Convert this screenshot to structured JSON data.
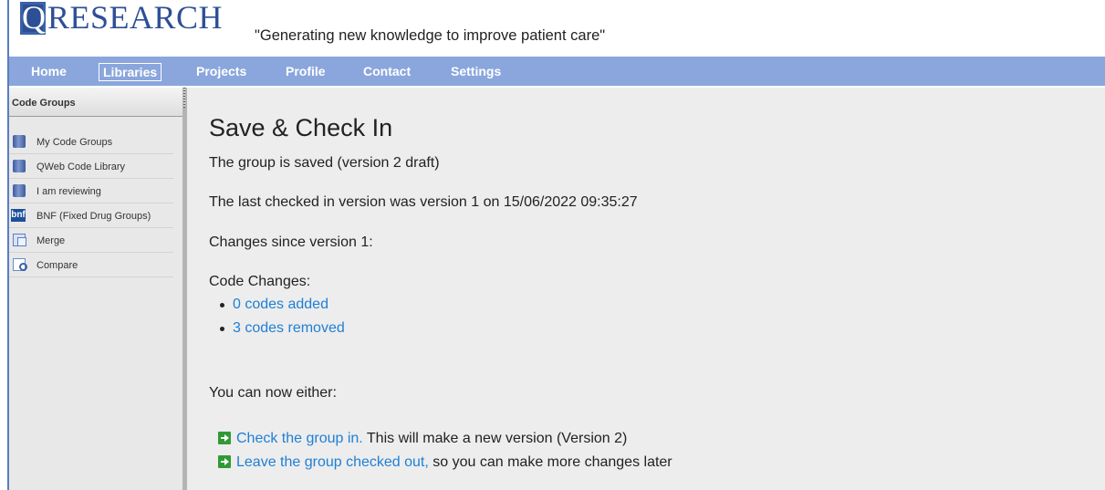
{
  "header": {
    "logo_q": "Q",
    "logo_text": "RESEARCH",
    "tagline": "\"Generating new knowledge to improve patient care\""
  },
  "nav": {
    "items": [
      {
        "label": "Home"
      },
      {
        "label": "Libraries",
        "active": true
      },
      {
        "label": "Projects"
      },
      {
        "label": "Profile"
      },
      {
        "label": "Contact"
      },
      {
        "label": "Settings"
      }
    ]
  },
  "sidebar": {
    "title": "Code Groups",
    "items": [
      {
        "label": "My Code Groups",
        "icon": "database-icon"
      },
      {
        "label": "QWeb Code Library",
        "icon": "database-icon"
      },
      {
        "label": "I am reviewing",
        "icon": "database-icon"
      },
      {
        "label": "BNF (Fixed Drug Groups)",
        "icon": "bnf-icon",
        "icon_text": "bnf"
      },
      {
        "label": "Merge",
        "icon": "merge-icon"
      },
      {
        "label": "Compare",
        "icon": "compare-icon"
      }
    ]
  },
  "main": {
    "title": "Save & Check In",
    "saved_text": "The group is saved (version 2 draft)",
    "last_checked_in": "The last checked in version was version 1 on 15/06/2022 09:35:27",
    "changes_since": "Changes since version 1:",
    "code_changes_label": "Code Changes:",
    "code_changes": [
      {
        "label": "0 codes added"
      },
      {
        "label": "3 codes removed"
      }
    ],
    "either_text": "You can now either:",
    "actions": [
      {
        "link": "Check the group in.",
        "rest": " This will make a new version (Version 2)"
      },
      {
        "link": "Leave the group checked out,",
        "rest": " so you can make more changes later"
      }
    ]
  },
  "colors": {
    "nav_bg": "#8aa6dc",
    "link": "#1e7fd6",
    "logo_blue": "#2d4f95",
    "action_icon_green": "#2f9a34"
  }
}
